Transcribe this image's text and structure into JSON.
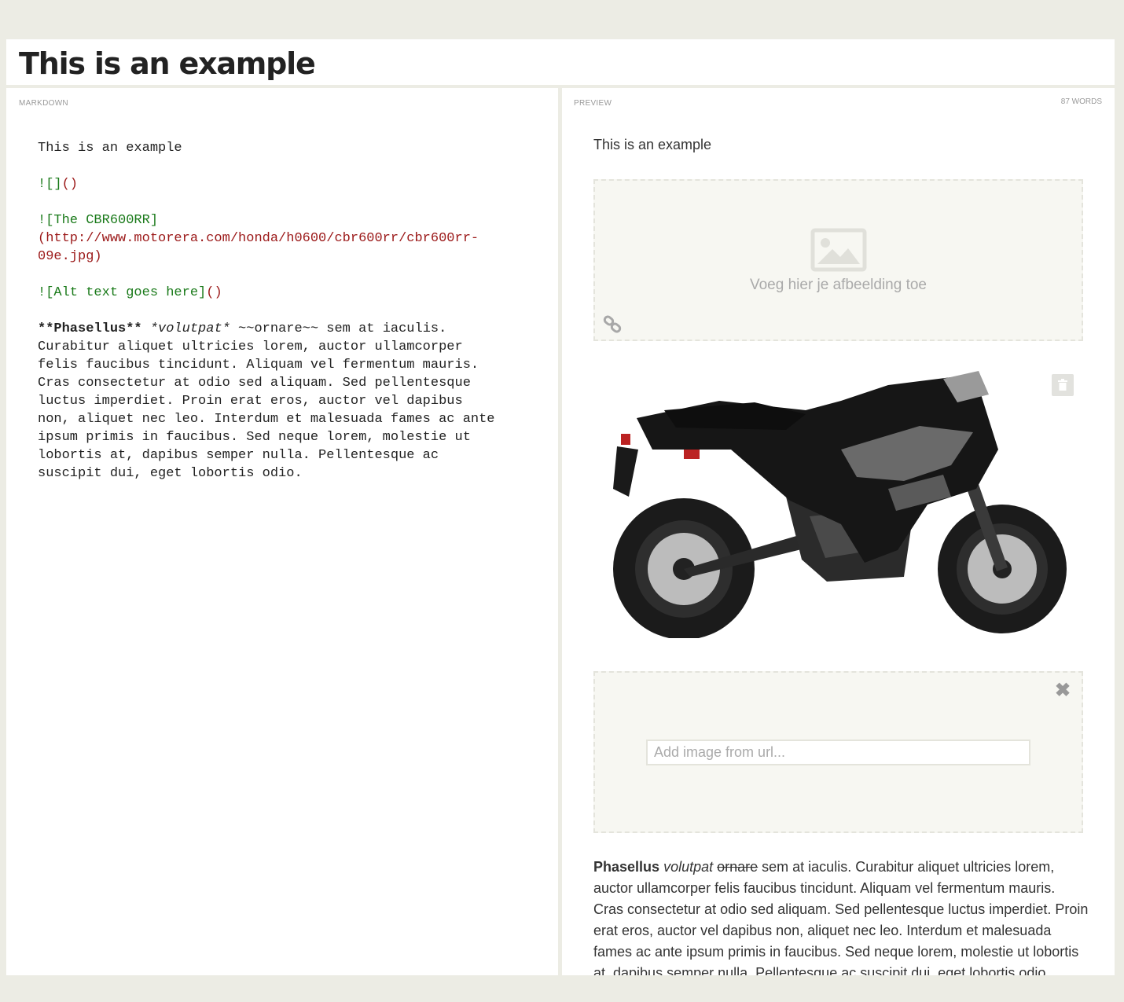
{
  "document": {
    "title": "This is an example"
  },
  "editor": {
    "label": "Markdown",
    "line1": "This is an example",
    "img_empty": {
      "mark": "![]",
      "paren": "()"
    },
    "img_cbr": {
      "mark": "![The CBR600RR]",
      "url_line1": "(http://www.motorera.com/honda/h0600/cbr600rr/cbr600rr-",
      "url_line2": "09e.jpg)"
    },
    "img_alt": {
      "mark": "![Alt text goes here]",
      "paren": "()"
    },
    "para": {
      "bold": "**Phasellus**",
      "italic": "*volutpat*",
      "rest_first": " ~~ornare~~ sem at iaculis.",
      "lines": [
        "Curabitur aliquet ultricies lorem, auctor ullamcorper",
        "felis faucibus tincidunt. Aliquam vel fermentum mauris.",
        "Cras consectetur at odio sed aliquam. Sed pellentesque",
        "luctus imperdiet. Proin erat eros, auctor vel dapibus",
        "non, aliquet nec leo. Interdum et malesuada fames ac ante",
        "ipsum primis in faucibus. Sed neque lorem, molestie ut",
        "lobortis at, dapibus semper nulla. Pellentesque ac",
        "suscipit dui, eget lobortis odio."
      ]
    }
  },
  "preview": {
    "label": "Preview",
    "word_count": "87 words",
    "title": "This is an example",
    "drop_text": "Voeg hier je afbeelding toe",
    "image_alt": "The CBR600RR",
    "url_placeholder": "Add image from url...",
    "close_glyph": "✖",
    "para": {
      "bold": "Phasellus",
      "italic": "volutpat",
      "strike": "ornare",
      "rest": " sem at iaculis. Curabitur aliquet ultricies lorem, auctor ullamcorper felis faucibus tincidunt. Aliquam vel fermentum mauris. Cras consectetur at odio sed aliquam. Sed pellentesque luctus imperdiet. Proin erat eros, auctor vel dapibus non, aliquet nec leo. Interdum et malesuada fames ac ante ipsum primis in faucibus. Sed neque lorem, molestie ut lobortis at, dapibus semper nulla. Pellentesque ac suscipit dui, eget lobortis odio."
    }
  }
}
